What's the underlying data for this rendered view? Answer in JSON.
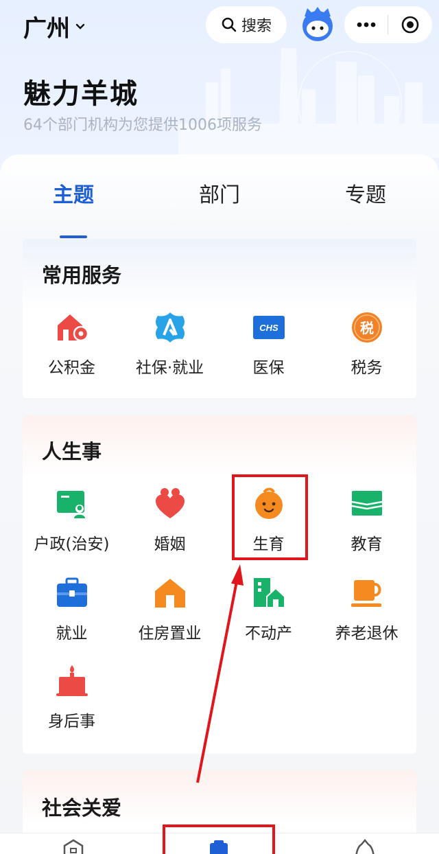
{
  "header": {
    "city": "广州",
    "search_label": "搜索",
    "hero_title": "魅力羊城",
    "hero_subtitle": "64个部门机构为您提供1006项服务"
  },
  "tabs": [
    {
      "label": "主题",
      "active": true
    },
    {
      "label": "部门",
      "active": false
    },
    {
      "label": "专题",
      "active": false
    }
  ],
  "sections": {
    "common": {
      "title": "常用服务",
      "items": [
        {
          "label": "公积金",
          "icon": "house-fund-icon"
        },
        {
          "label": "社保·就业",
          "icon": "social-security-icon"
        },
        {
          "label": "医保",
          "icon": "chs-medical-insurance-icon"
        },
        {
          "label": "税务",
          "icon": "tax-icon"
        }
      ]
    },
    "life": {
      "title": "人生事",
      "items": [
        {
          "label": "户政(治安)",
          "icon": "household-id-icon"
        },
        {
          "label": "婚姻",
          "icon": "marriage-heart-icon"
        },
        {
          "label": "生育",
          "icon": "baby-face-icon"
        },
        {
          "label": "教育",
          "icon": "book-icon"
        },
        {
          "label": "就业",
          "icon": "briefcase-icon"
        },
        {
          "label": "住房置业",
          "icon": "house-icon"
        },
        {
          "label": "不动产",
          "icon": "real-estate-icon"
        },
        {
          "label": "养老退休",
          "icon": "tea-cup-icon"
        },
        {
          "label": "身后事",
          "icon": "candle-icon"
        }
      ]
    },
    "social": {
      "title": "社会关爱"
    }
  },
  "colors": {
    "accent": "#1f5fd6",
    "highlight": "#e0161c"
  }
}
